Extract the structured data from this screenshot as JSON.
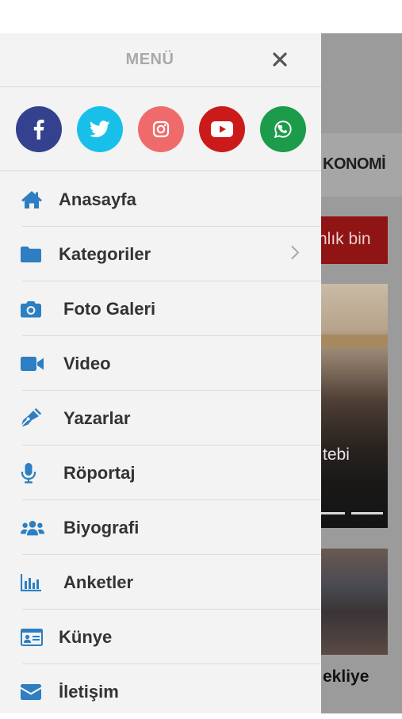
{
  "drawer": {
    "title": "MENÜ",
    "social": [
      {
        "name": "facebook-icon",
        "color": "#33418f"
      },
      {
        "name": "twitter-icon",
        "color": "#18c0e9"
      },
      {
        "name": "instagram-icon",
        "color": "#ef6b6b"
      },
      {
        "name": "youtube-icon",
        "color": "#cc1a1a"
      },
      {
        "name": "whatsapp-icon",
        "color": "#1c9b4a"
      }
    ],
    "items": [
      {
        "label": "Anasayfa",
        "icon": "home-icon"
      },
      {
        "label": "Kategoriler",
        "icon": "folder-icon"
      },
      {
        "label": "Foto Galeri",
        "icon": "camera-icon"
      },
      {
        "label": "Video",
        "icon": "video-icon"
      },
      {
        "label": "Yazarlar",
        "icon": "pen-icon"
      },
      {
        "label": "Röportaj",
        "icon": "microphone-icon"
      },
      {
        "label": "Biyografi",
        "icon": "users-icon"
      },
      {
        "label": "Anketler",
        "icon": "poll-chart-icon"
      },
      {
        "label": "Künye",
        "icon": "id-card-icon"
      },
      {
        "label": "İletişim",
        "icon": "envelope-icon"
      }
    ],
    "accent": "#2d7fc1"
  },
  "background": {
    "nav_text": "KONOMİ",
    "banner_text": "nlık bin",
    "headline1": "tebi",
    "headline2": "ekliye"
  }
}
